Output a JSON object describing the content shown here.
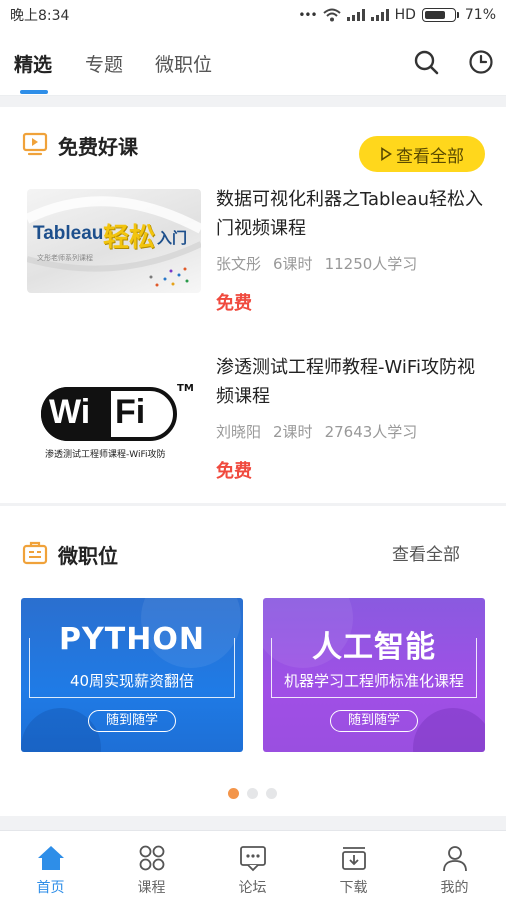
{
  "status_bar": {
    "time": "晚上8:34",
    "dots": "•••",
    "network": "HD",
    "battery": "71%",
    "battery_level": 0.71
  },
  "top_nav": {
    "tabs": [
      {
        "label": "精选"
      },
      {
        "label": "专题"
      },
      {
        "label": "微职位"
      }
    ],
    "icons": {
      "search": "search-icon",
      "history": "clock-icon"
    }
  },
  "free_courses": {
    "title": "免费好课",
    "view_all": "查看全部",
    "courses": [
      {
        "title": "数据可视化利器之Tableau轻松入门视频课程",
        "author": "张文彤",
        "lessons": "6课时",
        "learners": "11250人学习",
        "price": "免费",
        "thumb": {
          "brand": "Tableau",
          "highlight": "轻松",
          "suffix": "入门",
          "caption": "文彤老师系列课程"
        }
      },
      {
        "title": "渗透测试工程师教程-WiFi攻防视频课程",
        "author": "刘晓阳",
        "lessons": "2课时",
        "learners": "27643人学习",
        "price": "免费",
        "thumb": {
          "logo_left": "Wi",
          "logo_right": "Fi",
          "tm": "TM",
          "caption": "渗透测试工程师课程-WiFi攻防"
        }
      }
    ]
  },
  "micro_jobs": {
    "title": "微职位",
    "view_all": "查看全部",
    "banners": [
      {
        "title": "PYTHON",
        "subtitle": "40周实现薪资翻倍",
        "chip": "随到随学",
        "color": "#1e6fd6"
      },
      {
        "title": "人工智能",
        "subtitle": "机器学习工程师标准化课程",
        "chip": "随到随学",
        "color": "#9a4fe0"
      }
    ],
    "carousel_active": 1,
    "carousel_total": 3
  },
  "bottom_nav": {
    "items": [
      {
        "label": "首页",
        "icon": "home-icon",
        "active": true
      },
      {
        "label": "课程",
        "icon": "grid-icon",
        "active": false
      },
      {
        "label": "论坛",
        "icon": "chat-icon",
        "active": false
      },
      {
        "label": "下载",
        "icon": "download-icon",
        "active": false
      },
      {
        "label": "我的",
        "icon": "user-icon",
        "active": false
      }
    ]
  },
  "colors": {
    "accent": "#2e8ee8",
    "price": "#f04a3e",
    "pill": "#ffd71c",
    "section_icon": "#f0a23a"
  }
}
